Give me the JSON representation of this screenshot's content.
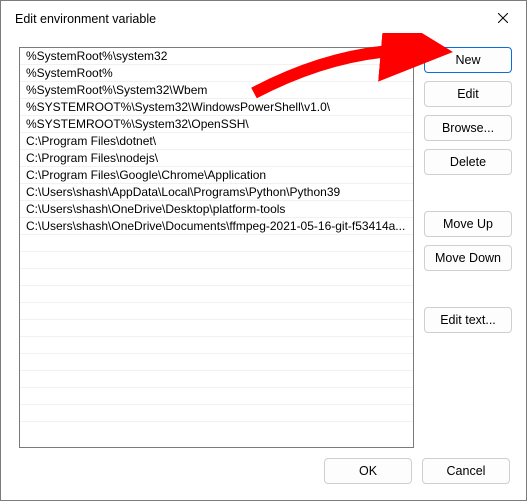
{
  "window": {
    "title": "Edit environment variable"
  },
  "paths": [
    "%SystemRoot%\\system32",
    "%SystemRoot%",
    "%SystemRoot%\\System32\\Wbem",
    "%SYSTEMROOT%\\System32\\WindowsPowerShell\\v1.0\\",
    "%SYSTEMROOT%\\System32\\OpenSSH\\",
    "C:\\Program Files\\dotnet\\",
    "C:\\Program Files\\nodejs\\",
    "C:\\Program Files\\Google\\Chrome\\Application",
    "C:\\Users\\shash\\AppData\\Local\\Programs\\Python\\Python39",
    "C:\\Users\\shash\\OneDrive\\Desktop\\platform-tools",
    "C:\\Users\\shash\\OneDrive\\Documents\\ffmpeg-2021-05-16-git-f53414a..."
  ],
  "buttons": {
    "new": "New",
    "edit": "Edit",
    "browse": "Browse...",
    "delete": "Delete",
    "moveup": "Move Up",
    "movedown": "Move Down",
    "edittext": "Edit text...",
    "ok": "OK",
    "cancel": "Cancel"
  },
  "annotation": {
    "arrow_color": "#ff0000"
  }
}
